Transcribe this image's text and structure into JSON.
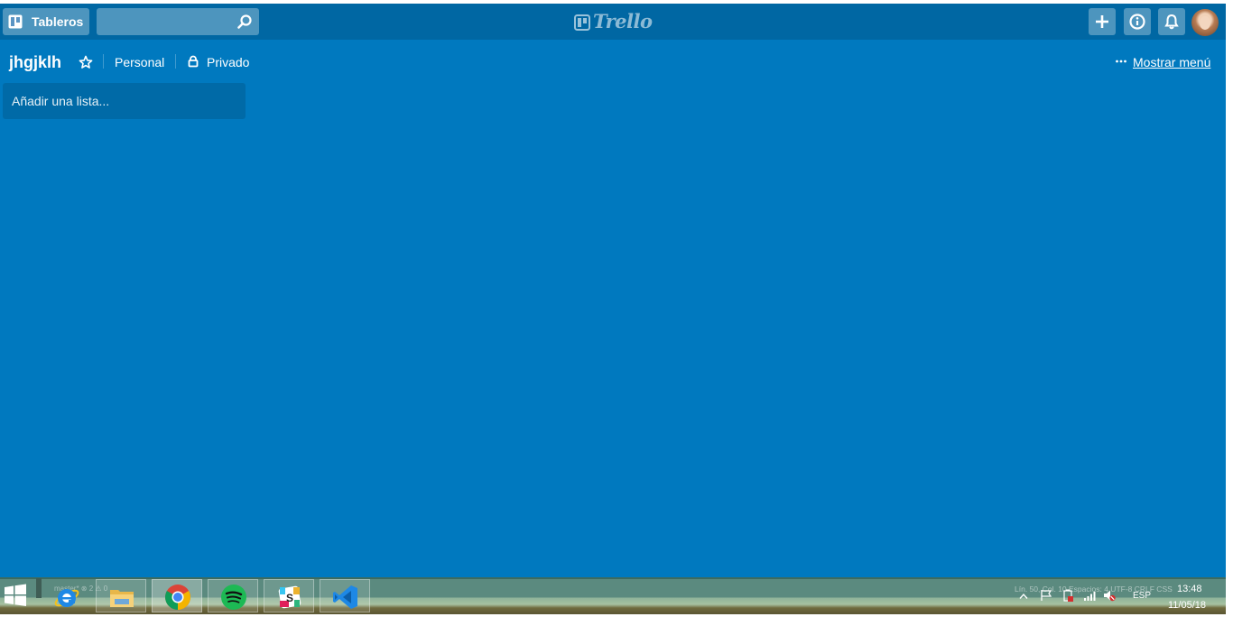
{
  "header": {
    "boards_label": "Tableros",
    "search_value": "",
    "logo_text": "Trello"
  },
  "board": {
    "title": "jhgjklh",
    "team": "Personal",
    "privacy": "Privado",
    "show_menu": "Mostrar menú",
    "add_list_placeholder": "Añadir una lista..."
  },
  "taskbar": {
    "apps": [
      "internet-explorer",
      "file-explorer",
      "chrome",
      "spotify",
      "slack",
      "visual-studio-code"
    ],
    "ghost_left": "master*   ⊗ 2 ⚠ 0",
    "ghost_right": "Lín. 50, Col. 10   Espacios: 4   UTF-8   CRLF   CSS",
    "language": "ESP",
    "time": "13:48",
    "date": "11/05/18"
  },
  "colors": {
    "board_bg": "#0079bf",
    "header_bg": "#0067a3"
  }
}
